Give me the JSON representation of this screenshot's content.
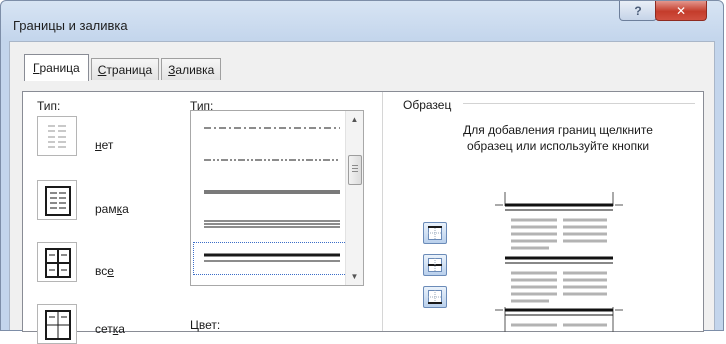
{
  "window": {
    "title": "Границы и заливка",
    "help_glyph": "?",
    "close_glyph": "✕"
  },
  "tabs": [
    {
      "label_u": "Г",
      "label_rest": "раница",
      "active": true
    },
    {
      "label_u": "С",
      "label_rest": "траница",
      "active": false
    },
    {
      "label_u": "З",
      "label_rest": "аливка",
      "active": false
    }
  ],
  "setting": {
    "label": "Тип:",
    "items": [
      {
        "u": "н",
        "rest": "ет",
        "pre": ""
      },
      {
        "pre": "рам",
        "u": "к",
        "rest": "а"
      },
      {
        "pre": "вс",
        "u": "е",
        "rest": ""
      },
      {
        "pre": "сет",
        "u": "к",
        "rest": "а"
      }
    ]
  },
  "style": {
    "label_pre": "Т",
    "label_u": "и",
    "label_rest": "п:",
    "items": [
      "dash-dot",
      "dash-dot-dot",
      "double-thick",
      "triple-thin",
      "thick-thin"
    ],
    "selected_index": 4
  },
  "color": {
    "label": "Цвет:"
  },
  "preview": {
    "label": "Образец",
    "hint": "Для добавления границ щелкните образец или используйте кнопки"
  },
  "colors": {
    "title_gradient_top": "#d7e4f3",
    "close_red": "#c43c2b",
    "selection": "#3c6ec8"
  }
}
